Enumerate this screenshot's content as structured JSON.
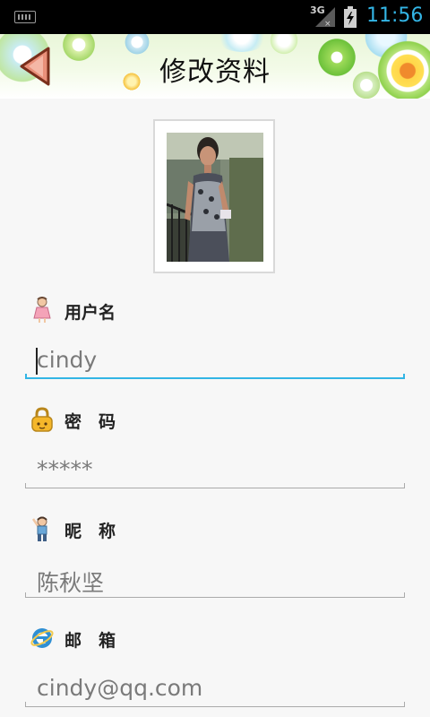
{
  "status_bar": {
    "network": "3G",
    "time": "11:56"
  },
  "header": {
    "title": "修改资料"
  },
  "form": {
    "username": {
      "label": "用户名",
      "value": "cindy"
    },
    "password": {
      "label": "密　码",
      "value": "*****"
    },
    "nickname": {
      "label": "昵　称",
      "value": "陈秋坚"
    },
    "email": {
      "label": "邮　箱",
      "value": "cindy@qq.com"
    }
  },
  "colors": {
    "accent": "#33b5e5",
    "status_bar_bg": "#000000",
    "page_bg": "#f7f7f7"
  },
  "icons": [
    "keyboard-icon",
    "signal-icon",
    "battery-charging-icon",
    "back-arrow-icon",
    "girl-icon",
    "padlock-icon",
    "waving-kid-icon",
    "ie-email-icon"
  ]
}
